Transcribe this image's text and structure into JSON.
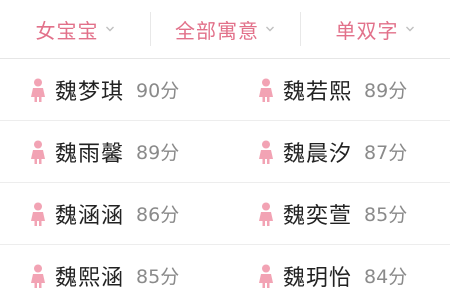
{
  "filters": [
    {
      "label": "女宝宝"
    },
    {
      "label": "全部寓意"
    },
    {
      "label": "单双字"
    }
  ],
  "colors": {
    "accent": "#e2718a",
    "icon": "#f2a3b4",
    "name": "#222222",
    "score": "#8a8a8a",
    "divider": "#ededed"
  },
  "icons": {
    "filter_arrow": "chevron-down-icon",
    "gender": "girl-icon"
  },
  "names": [
    [
      {
        "name": "魏梦琪",
        "score": "90分"
      },
      {
        "name": "魏若熙",
        "score": "89分"
      }
    ],
    [
      {
        "name": "魏雨馨",
        "score": "89分"
      },
      {
        "name": "魏晨汐",
        "score": "87分"
      }
    ],
    [
      {
        "name": "魏涵涵",
        "score": "86分"
      },
      {
        "name": "魏奕萱",
        "score": "85分"
      }
    ],
    [
      {
        "name": "魏熙涵",
        "score": "85分"
      },
      {
        "name": "魏玥怡",
        "score": "84分"
      }
    ]
  ]
}
